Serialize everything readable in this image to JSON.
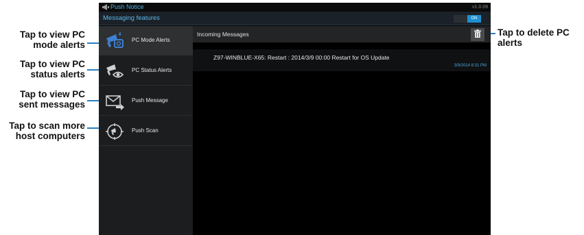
{
  "callouts": {
    "pc_mode": [
      "Tap to view PC",
      "mode alerts"
    ],
    "pc_status": [
      "Tap to view PC",
      "status alerts"
    ],
    "push_message": [
      "Tap to view PC",
      "sent messages"
    ],
    "push_scan": [
      "Tap to scan more",
      "host computers"
    ],
    "delete": [
      "Tap to  delete PC",
      "alerts"
    ]
  },
  "app": {
    "title": "Push Notice",
    "version": "v1.0.09"
  },
  "feature_bar": {
    "title": "Messaging features",
    "toggle_label": "ON"
  },
  "sidebar": {
    "items": [
      {
        "label": "PC Mode Alerts",
        "icon": "pc-mode-alerts-icon"
      },
      {
        "label": "PC Status Alerts",
        "icon": "pc-status-alerts-icon"
      },
      {
        "label": "Push Message",
        "icon": "push-message-icon"
      },
      {
        "label": "Push Scan",
        "icon": "push-scan-icon"
      }
    ]
  },
  "main": {
    "title": "Incoming Messages",
    "messages": [
      {
        "text": "Z97-WINBLUE-X65: Restart : 2014/3/9 00:00 Restart for OS Update",
        "time": "3/9/2014  8:31 PM"
      }
    ]
  },
  "colors": {
    "accent": "#1e8fd0",
    "title_blue": "#4db0e6",
    "callout_line": "#2a7fc0",
    "background": "#000000",
    "sidebar": "#1c1d1f"
  }
}
